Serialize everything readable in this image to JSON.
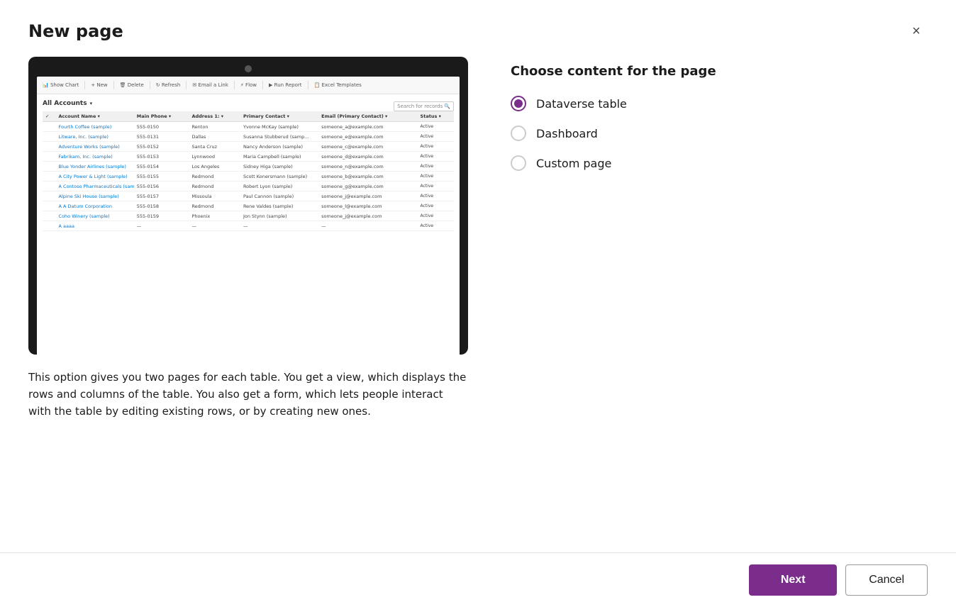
{
  "dialog": {
    "title": "New page",
    "close_label": "×"
  },
  "preview": {
    "toolbar_items": [
      "Show Chart",
      "+ New",
      "Delete",
      "Refresh",
      "Email a Link",
      "Flow",
      "Run Report",
      "Excel Templates"
    ],
    "accounts_header": "All Accounts",
    "search_placeholder": "Search for records",
    "columns": [
      "Account Name",
      "Main Phone",
      "Address 1:",
      "Primary Contact",
      "Email (Primary Contact)",
      "Status"
    ],
    "rows": [
      [
        "Fourth Coffee (sample)",
        "555-0150",
        "Renton",
        "Yvonne McKay (sample)",
        "someone_a@example.com",
        "Active"
      ],
      [
        "Litware, Inc. (sample)",
        "555-0131",
        "Dallas",
        "Susanna Stubberud (samp...",
        "someone_e@example.com",
        "Active"
      ],
      [
        "Adventure Works (sample)",
        "555-0152",
        "Santa Cruz",
        "Nancy Anderson (sample)",
        "someone_c@example.com",
        "Active"
      ],
      [
        "Fabrikam, Inc. (sample)",
        "555-0153",
        "Lynnwood",
        "Maria Campbell (sample)",
        "someone_d@example.com",
        "Active"
      ],
      [
        "Blue Yonder Airlines (sample)",
        "555-0154",
        "Los Angeles",
        "Sidney Higa (sample)",
        "someone_n@example.com",
        "Active"
      ],
      [
        "A City Power & Light (sample)",
        "555-0155",
        "Redmond",
        "Scott Konersmann (sample)",
        "someone_b@example.com",
        "Active"
      ],
      [
        "A Contoso Pharmaceuticals (sample)",
        "555-0156",
        "Redmond",
        "Robert Lyon (sample)",
        "someone_g@example.com",
        "Active"
      ],
      [
        "Alpine Ski House (sample)",
        "555-0157",
        "Missoula",
        "Paul Cannon (sample)",
        "someone_j@example.com",
        "Active"
      ],
      [
        "A A Datum Corporation",
        "555-0158",
        "Redmond",
        "Rene Valdes (sample)",
        "someone_l@example.com",
        "Active"
      ],
      [
        "Coho Winery (sample)",
        "555-0159",
        "Phoenix",
        "Jon Stynn (sample)",
        "someone_j@example.com",
        "Active"
      ],
      [
        "A aaaa",
        "—",
        "—",
        "—",
        "—",
        "Active"
      ]
    ]
  },
  "description": "This option gives you two pages for each table. You get a view, which displays the rows and columns of the table. You also get a form, which lets people interact with the table by editing existing rows, or by creating new ones.",
  "right_panel": {
    "title": "Choose content for the page",
    "options": [
      {
        "id": "dataverse",
        "label": "Dataverse table",
        "selected": true
      },
      {
        "id": "dashboard",
        "label": "Dashboard",
        "selected": false
      },
      {
        "id": "custom",
        "label": "Custom page",
        "selected": false
      }
    ]
  },
  "footer": {
    "next_label": "Next",
    "cancel_label": "Cancel"
  }
}
